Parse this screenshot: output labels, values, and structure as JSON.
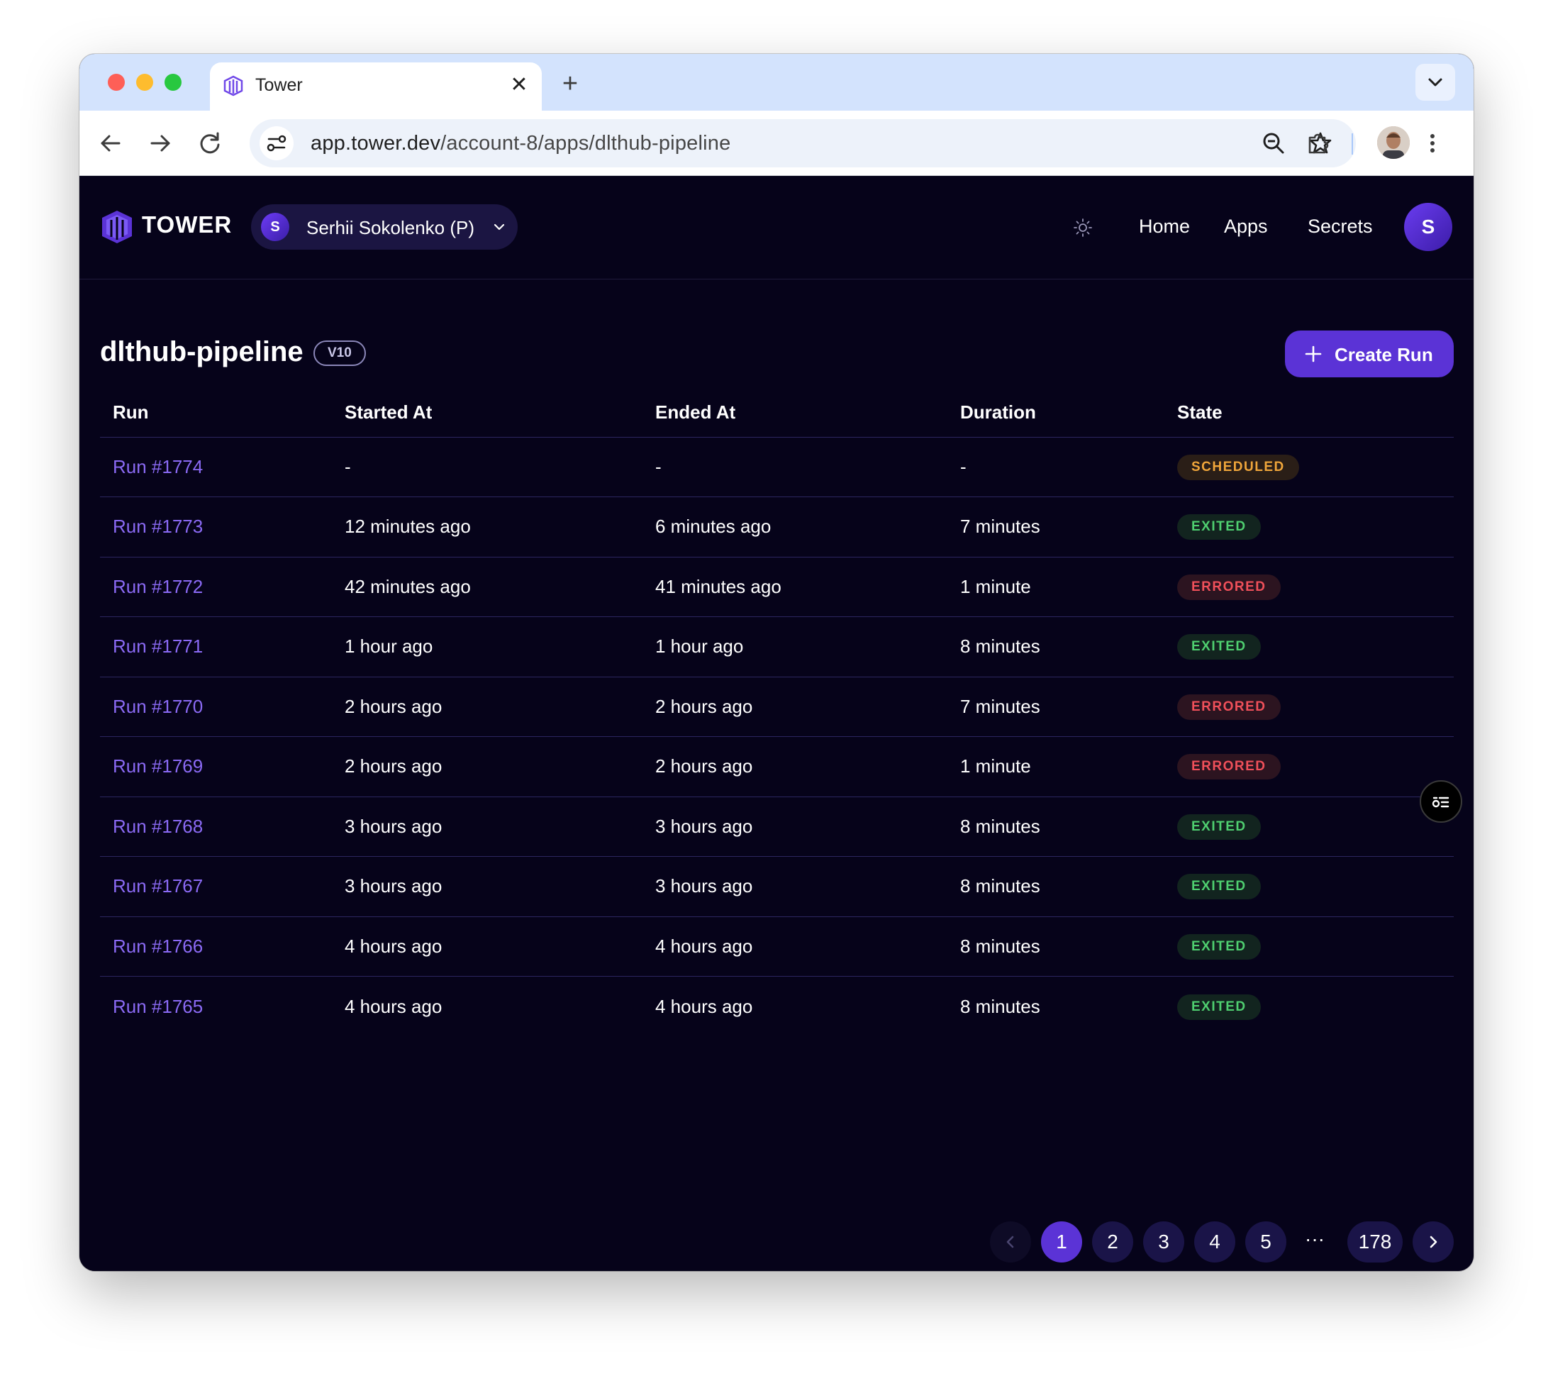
{
  "browser": {
    "tab_title": "Tower",
    "tab_close": "✕",
    "new_tab": "+",
    "url_host": "app.tower.dev",
    "url_path": "/account-8/apps/dlthub-pipeline"
  },
  "header": {
    "logo_text": "TOWER",
    "account_initial": "S",
    "account_name": "Serhii Sokolenko (P)",
    "nav": [
      "Home",
      "Apps",
      "Secrets"
    ],
    "user_initial": "S"
  },
  "page": {
    "title": "dlthub-pipeline",
    "version": "V10",
    "create_run_label": "Create Run"
  },
  "table": {
    "columns": [
      "Run",
      "Started At",
      "Ended At",
      "Duration",
      "State"
    ],
    "rows": [
      {
        "run": "Run #1774",
        "started": "-",
        "ended": "-",
        "duration": "-",
        "state": "SCHEDULED"
      },
      {
        "run": "Run #1773",
        "started": "12 minutes ago",
        "ended": "6 minutes ago",
        "duration": "7 minutes",
        "state": "EXITED"
      },
      {
        "run": "Run #1772",
        "started": "42 minutes ago",
        "ended": "41 minutes ago",
        "duration": "1 minute",
        "state": "ERRORED"
      },
      {
        "run": "Run #1771",
        "started": "1 hour ago",
        "ended": "1 hour ago",
        "duration": "8 minutes",
        "state": "EXITED"
      },
      {
        "run": "Run #1770",
        "started": "2 hours ago",
        "ended": "2 hours ago",
        "duration": "7 minutes",
        "state": "ERRORED"
      },
      {
        "run": "Run #1769",
        "started": "2 hours ago",
        "ended": "2 hours ago",
        "duration": "1 minute",
        "state": "ERRORED"
      },
      {
        "run": "Run #1768",
        "started": "3 hours ago",
        "ended": "3 hours ago",
        "duration": "8 minutes",
        "state": "EXITED"
      },
      {
        "run": "Run #1767",
        "started": "3 hours ago",
        "ended": "3 hours ago",
        "duration": "8 minutes",
        "state": "EXITED"
      },
      {
        "run": "Run #1766",
        "started": "4 hours ago",
        "ended": "4 hours ago",
        "duration": "8 minutes",
        "state": "EXITED"
      },
      {
        "run": "Run #1765",
        "started": "4 hours ago",
        "ended": "4 hours ago",
        "duration": "8 minutes",
        "state": "EXITED"
      }
    ]
  },
  "pagination": {
    "current": "1",
    "pages": [
      "1",
      "2",
      "3",
      "4",
      "5"
    ],
    "ellipsis": "···",
    "last": "178"
  },
  "colors": {
    "accent": "#5b33d6",
    "link": "#8b6af5",
    "background": "#06031a",
    "scheduled": "#f0a63b",
    "exited": "#4fcf70",
    "errored": "#f0505a"
  },
  "icons": {
    "favicon": "tower-logo-icon",
    "back": "arrow-left-icon",
    "forward": "arrow-right-icon",
    "reload": "reload-icon",
    "site_settings": "tune-icon",
    "zoom": "zoom-out-icon",
    "bookmark": "star-icon",
    "extensions": "puzzle-icon",
    "menu": "kebab-menu-icon",
    "theme": "sun-icon",
    "floating": "list-settings-icon"
  }
}
